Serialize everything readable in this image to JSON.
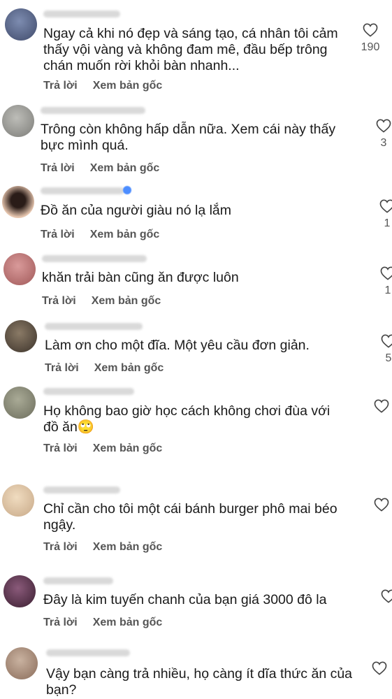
{
  "actions": {
    "reply_label": "Trả lời",
    "view_original_label": "Xem bản gốc"
  },
  "comments": [
    {
      "lines": [
        "Ngay cả khi nó đẹp và sáng tạo, cá nhân tôi cảm",
        "thấy vội vàng và không đam mê, đầu bếp trông",
        "chán muốn rời khỏi bàn nhanh..."
      ],
      "likes": "190",
      "avatar_color": "#5a6a8a"
    },
    {
      "lines": [
        "Trông còn không hấp dẫn nữa. Xem cái này thấy",
        "bực mình quá."
      ],
      "likes": "3",
      "avatar_color": "#9a9a96"
    },
    {
      "lines": [
        "Đồ ăn của người giàu nó lạ lắm"
      ],
      "likes": "1",
      "avatar_color": "#3a2a24"
    },
    {
      "lines": [
        "khăn trải bàn cũng ăn được luôn"
      ],
      "likes": "1",
      "avatar_color": "#c07878"
    },
    {
      "lines": [
        "Làm ơn cho một đĩa. Một yêu cầu đơn giản."
      ],
      "likes": "5",
      "avatar_color": "#5b5046"
    },
    {
      "lines": [
        "Họ không bao giờ học cách không chơi đùa với",
        "đồ ăn🙄"
      ],
      "likes": "",
      "avatar_color": "#8d8e7c"
    },
    {
      "lines": [
        "Chỉ cần cho tôi một cái bánh burger phô mai béo",
        "ngậy."
      ],
      "likes": "",
      "avatar_color": "#e0c8a8"
    },
    {
      "lines": [
        "Đây là kim tuyến chanh của bạn giá 3000 đô la"
      ],
      "likes": "",
      "avatar_color": "#4a3040"
    },
    {
      "lines": [
        "Vậy bạn càng trả nhiều, họ càng ít dĩa thức ăn của",
        "bạn?"
      ],
      "likes": "",
      "avatar_color": "#b39a88"
    }
  ]
}
